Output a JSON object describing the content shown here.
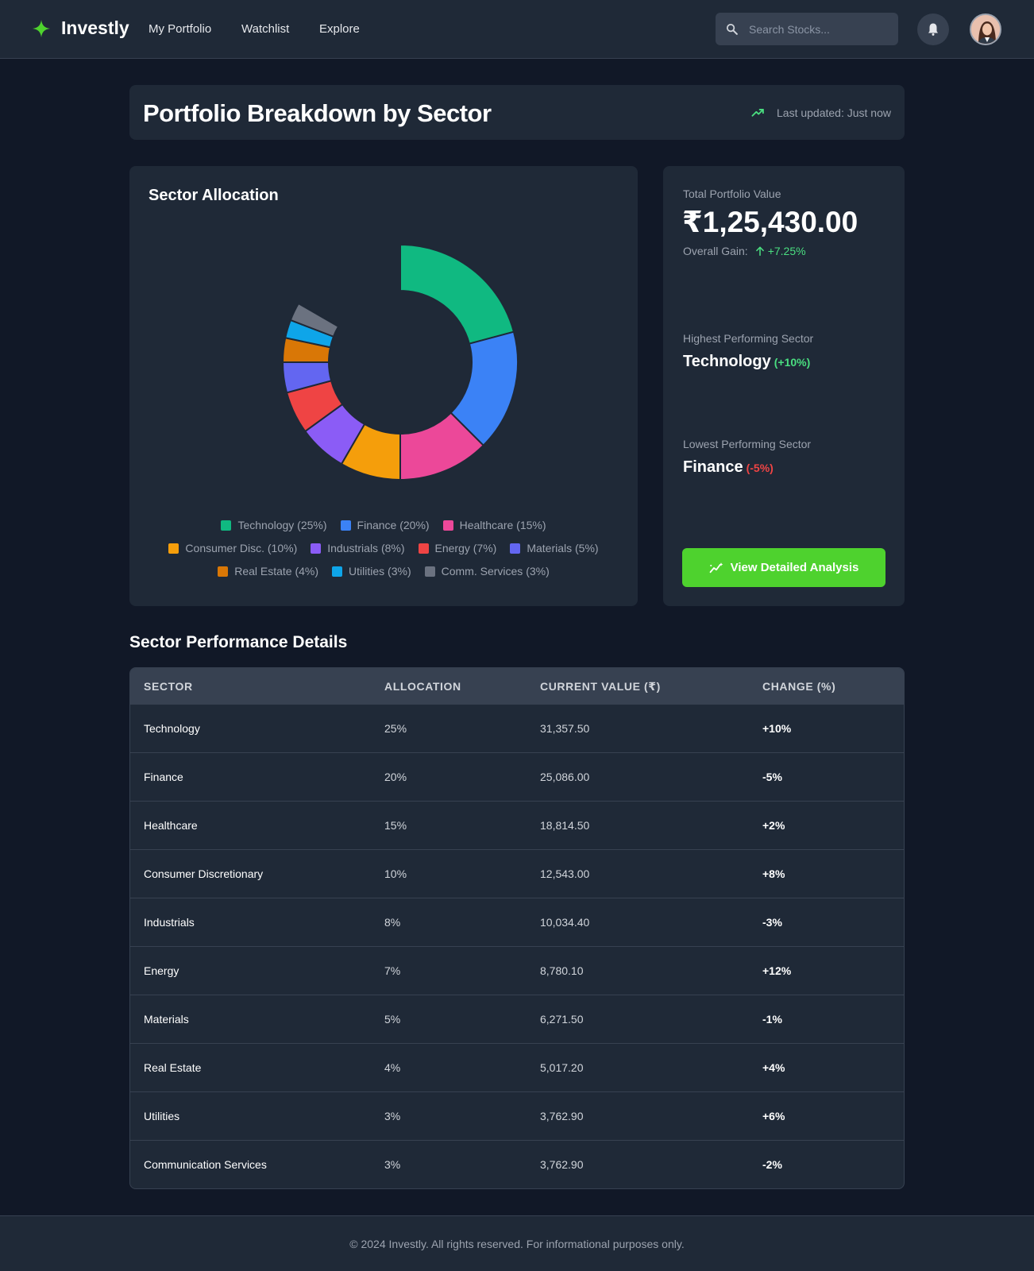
{
  "app": {
    "logo_text": "Investly",
    "brand_color": "#4ed22e"
  },
  "nav": {
    "links": [
      "My Portfolio",
      "Watchlist",
      "Explore"
    ],
    "search_placeholder": "Search Stocks..."
  },
  "header": {
    "title": "Portfolio Breakdown by Sector",
    "last_updated": "Last updated: Just now"
  },
  "chart_card": {
    "title": "Sector Allocation"
  },
  "chart_data": {
    "type": "pie",
    "title": "Sector Allocation",
    "categories": [
      "Technology",
      "Finance",
      "Healthcare",
      "Consumer Disc.",
      "Industrials",
      "Energy",
      "Materials",
      "Real Estate",
      "Utilities",
      "Comm. Services"
    ],
    "values": [
      25,
      20,
      15,
      10,
      8,
      7,
      5,
      4,
      3,
      3
    ],
    "colors": [
      "#10b981",
      "#3b82f6",
      "#ec4899",
      "#f59e0b",
      "#8b5cf6",
      "#ef4444",
      "#6366f1",
      "#d97706",
      "#0ea5e9",
      "#6b7280"
    ],
    "legend_labels": [
      "Technology (25%)",
      "Finance (20%)",
      "Healthcare (15%)",
      "Consumer Disc. (10%)",
      "Industrials (8%)",
      "Energy (7%)",
      "Materials (5%)",
      "Real Estate (4%)",
      "Utilities (3%)",
      "Comm. Services (3%)"
    ],
    "donut": true,
    "legend_position": "bottom"
  },
  "summary": {
    "total_label": "Total Portfolio Value",
    "total_value": "₹1,25,430.00",
    "gain_label": "Overall Gain:",
    "gain_value": "+7.25%",
    "highest_label": "Highest Performing Sector",
    "highest_sector": "Technology",
    "highest_change": "(+10%)",
    "lowest_label": "Lowest Performing Sector",
    "lowest_sector": "Finance",
    "lowest_change": "(-5%)",
    "button_label": "View Detailed Analysis"
  },
  "table": {
    "section_title": "Sector Performance Details",
    "headers": [
      "SECTOR",
      "ALLOCATION",
      "CURRENT VALUE (₹)",
      "CHANGE (%)"
    ],
    "rows": [
      {
        "sector": "Technology",
        "allocation": "25%",
        "value": "31,357.50",
        "change": "+10%"
      },
      {
        "sector": "Finance",
        "allocation": "20%",
        "value": "25,086.00",
        "change": "-5%"
      },
      {
        "sector": "Healthcare",
        "allocation": "15%",
        "value": "18,814.50",
        "change": "+2%"
      },
      {
        "sector": "Consumer Discretionary",
        "allocation": "10%",
        "value": "12,543.00",
        "change": "+8%"
      },
      {
        "sector": "Industrials",
        "allocation": "8%",
        "value": "10,034.40",
        "change": "-3%"
      },
      {
        "sector": "Energy",
        "allocation": "7%",
        "value": "8,780.10",
        "change": "+12%"
      },
      {
        "sector": "Materials",
        "allocation": "5%",
        "value": "6,271.50",
        "change": "-1%"
      },
      {
        "sector": "Real Estate",
        "allocation": "4%",
        "value": "5,017.20",
        "change": "+4%"
      },
      {
        "sector": "Utilities",
        "allocation": "3%",
        "value": "3,762.90",
        "change": "+6%"
      },
      {
        "sector": "Communication Services",
        "allocation": "3%",
        "value": "3,762.90",
        "change": "-2%"
      }
    ]
  },
  "footer": {
    "text": "© 2024 Investly. All rights reserved. For informational purposes only."
  },
  "icons": [
    "sparkle-logo-icon",
    "search-icon",
    "bell-icon",
    "avatar",
    "trend-up-icon",
    "arrow-up-icon",
    "analytics-icon"
  ]
}
